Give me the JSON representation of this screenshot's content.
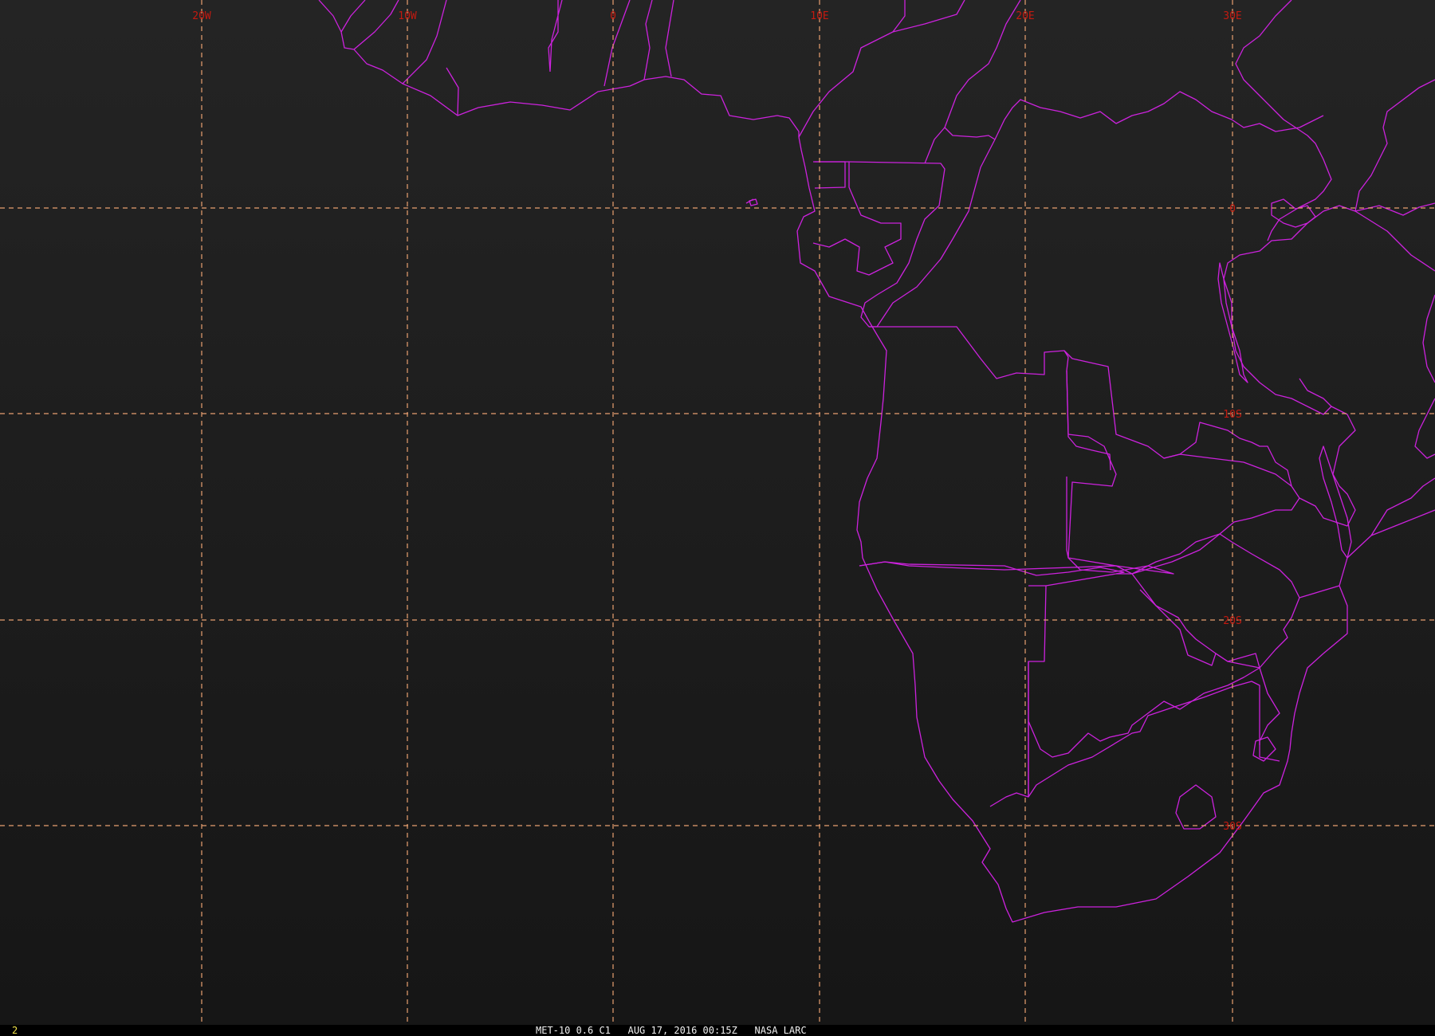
{
  "map": {
    "background": "#1b1b1b",
    "grid_color": "#e8a070",
    "label_color": "#c41a10",
    "boundary_color": "#cc22dd",
    "longitude_labels": [
      "20W",
      "10W",
      "0",
      "10E",
      "20E",
      "30E"
    ],
    "latitude_labels": [
      "0",
      "10S",
      "20S",
      "30S"
    ]
  },
  "status": {
    "frame_number": "2",
    "caption": "MET-10 0.6 C1   AUG 17, 2016 00:15Z   NASA LARC"
  }
}
